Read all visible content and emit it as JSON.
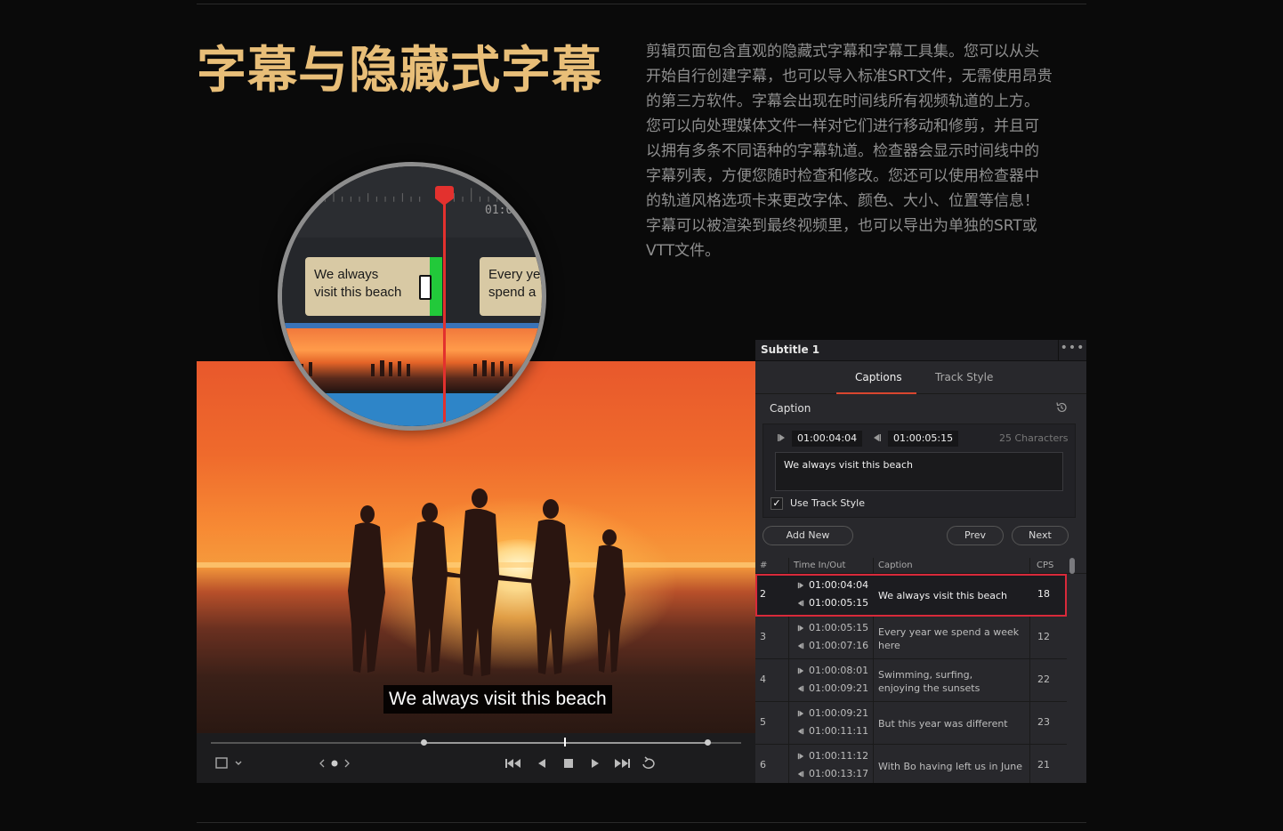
{
  "headline": "字幕与隐藏式字幕",
  "body_lines": [
    "剪辑页面包含直观的隐藏式字幕和字幕工具集。您可以从头",
    "开始自行创建字幕，也可以导入标准SRT文件，无需使用昂贵",
    "的第三方软件。字幕会出现在时间线所有视频轨道的上方。",
    "您可以向处理媒体文件一样对它们进行移动和修剪，并且可",
    "以拥有多条不同语种的字幕轨道。检查器会显示时间线中的",
    "字幕列表，方便您随时检查和修改。您还可以使用检查器中",
    "的轨道风格选项卡来更改字体、颜色、大小、位置等信息！",
    "字幕可以被渲染到最终视频里，也可以导出为单独的SRT或",
    "VTT文件。"
  ],
  "viewer": {
    "subtitle": "We always visit this beach"
  },
  "magnifier": {
    "timecode": "01:0",
    "clip_a": [
      "We always",
      "visit this beach"
    ],
    "clip_b": [
      "Every ye",
      "spend a"
    ]
  },
  "panel": {
    "title": "Subtitle 1",
    "menu": "•••",
    "tabs": [
      "Captions",
      "Track Style"
    ],
    "section": "Caption",
    "time_in": "01:00:04:04",
    "time_out": "01:00:05:15",
    "char_count": "25 Characters",
    "caption_text": "We always visit this beach",
    "checkbox_mark": "✓",
    "use_track_style": "Use Track Style",
    "add_new": "Add New",
    "prev": "Prev",
    "next": "Next",
    "columns": [
      "#",
      "Time In/Out",
      "Caption",
      "CPS"
    ],
    "rows": [
      {
        "num": "2",
        "in": "01:00:04:04",
        "out": "01:00:05:15",
        "caption": [
          "We always visit this beach"
        ],
        "cps": "18",
        "selected": true
      },
      {
        "num": "3",
        "in": "01:00:05:15",
        "out": "01:00:07:16",
        "caption": [
          "Every year we spend a week",
          "here"
        ],
        "cps": "12",
        "selected": false
      },
      {
        "num": "4",
        "in": "01:00:08:01",
        "out": "01:00:09:21",
        "caption": [
          "Swimming, surfing,",
          "enjoying the sunsets"
        ],
        "cps": "22",
        "selected": false
      },
      {
        "num": "5",
        "in": "01:00:09:21",
        "out": "01:00:11:11",
        "caption": [
          "But this year was different"
        ],
        "cps": "23",
        "selected": false
      },
      {
        "num": "6",
        "in": "01:00:11:12",
        "out": "01:00:13:17",
        "caption": [
          "With Bo having left us in June"
        ],
        "cps": "21",
        "selected": false
      }
    ]
  },
  "colors": {
    "headline": "#e8be78",
    "accent_red": "#d8293a",
    "playhead": "#e3312e",
    "clip_green": "#22c93a"
  }
}
